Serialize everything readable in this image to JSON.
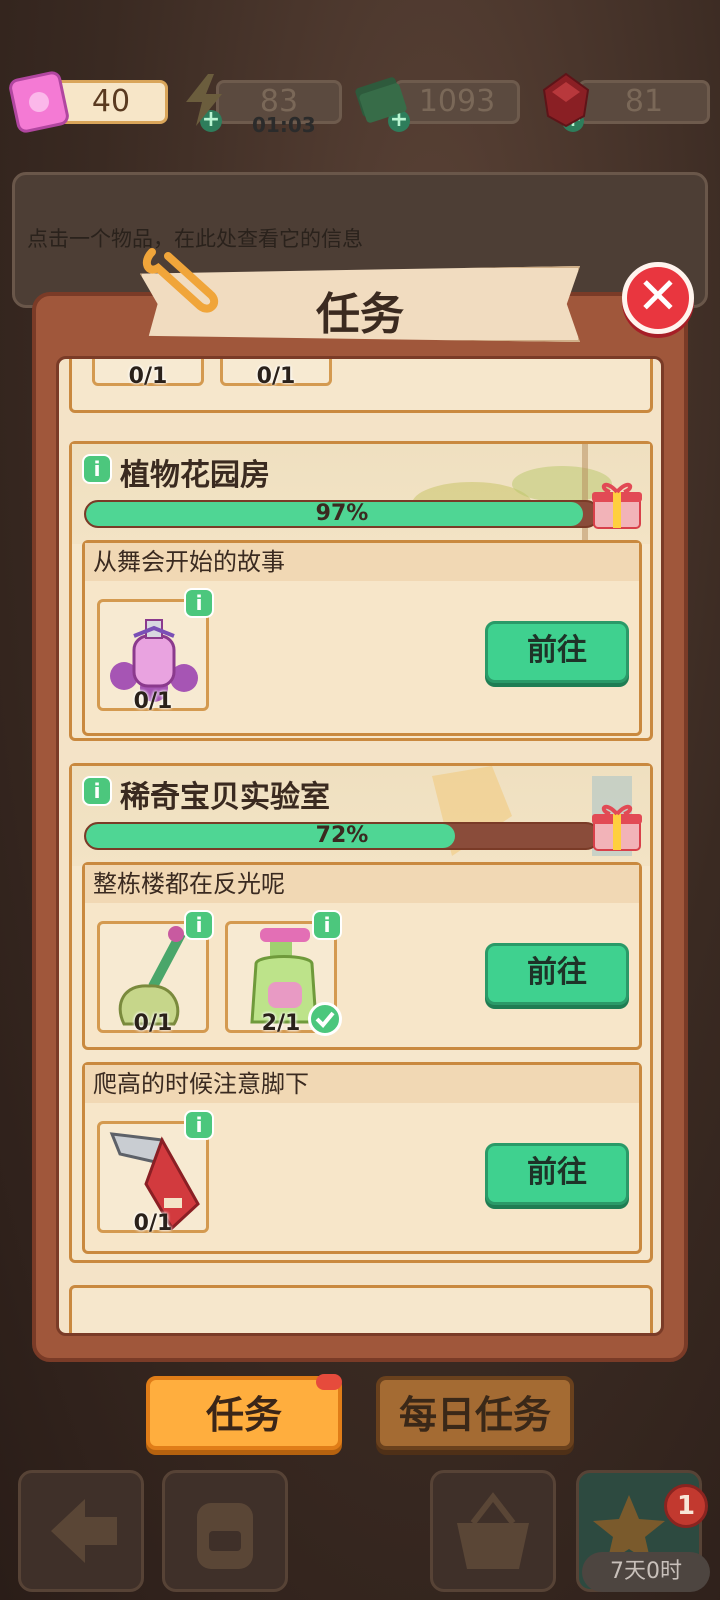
{
  "resources": {
    "tickets": "40",
    "energy": "83",
    "energy_timer": "01:03",
    "cash": "1093",
    "gems": "81"
  },
  "info_panel": {
    "hint": "点击一个物品，在此处查看它的信息"
  },
  "modal": {
    "title": "任务",
    "close": "✕",
    "partial_top": {
      "counts": [
        "0/1",
        "0/1"
      ]
    },
    "groups": [
      {
        "name": "植物花园房",
        "progress_text": "97%",
        "progress_value": 0.97,
        "tasks": [
          {
            "title": "从舞会开始的故事",
            "items": [
              {
                "icon": "perfume-bottle-icon",
                "count": "0/1",
                "done": false
              }
            ],
            "button": "前往"
          }
        ]
      },
      {
        "name": "稀奇宝贝实验室",
        "progress_text": "72%",
        "progress_value": 0.72,
        "tasks": [
          {
            "title": "整栋楼都在反光呢",
            "items": [
              {
                "icon": "mop-icon",
                "count": "0/1",
                "done": false
              },
              {
                "icon": "cleaner-bottle-icon",
                "count": "2/1",
                "done": true
              }
            ],
            "button": "前往"
          },
          {
            "title": "爬高的时候注意脚下",
            "items": [
              {
                "icon": "saw-icon",
                "count": "0/1",
                "done": false
              }
            ],
            "button": "前往"
          }
        ]
      }
    ]
  },
  "tabs": {
    "tasks": "任务",
    "daily": "每日任务"
  },
  "toolbar": {
    "badge": "1",
    "timer": "7天0时"
  },
  "info_badge_glyph": "i",
  "colors": {
    "accent_green": "#4fd694",
    "progress_track": "#8a4c3a",
    "tab_active": "#ffae3e"
  }
}
